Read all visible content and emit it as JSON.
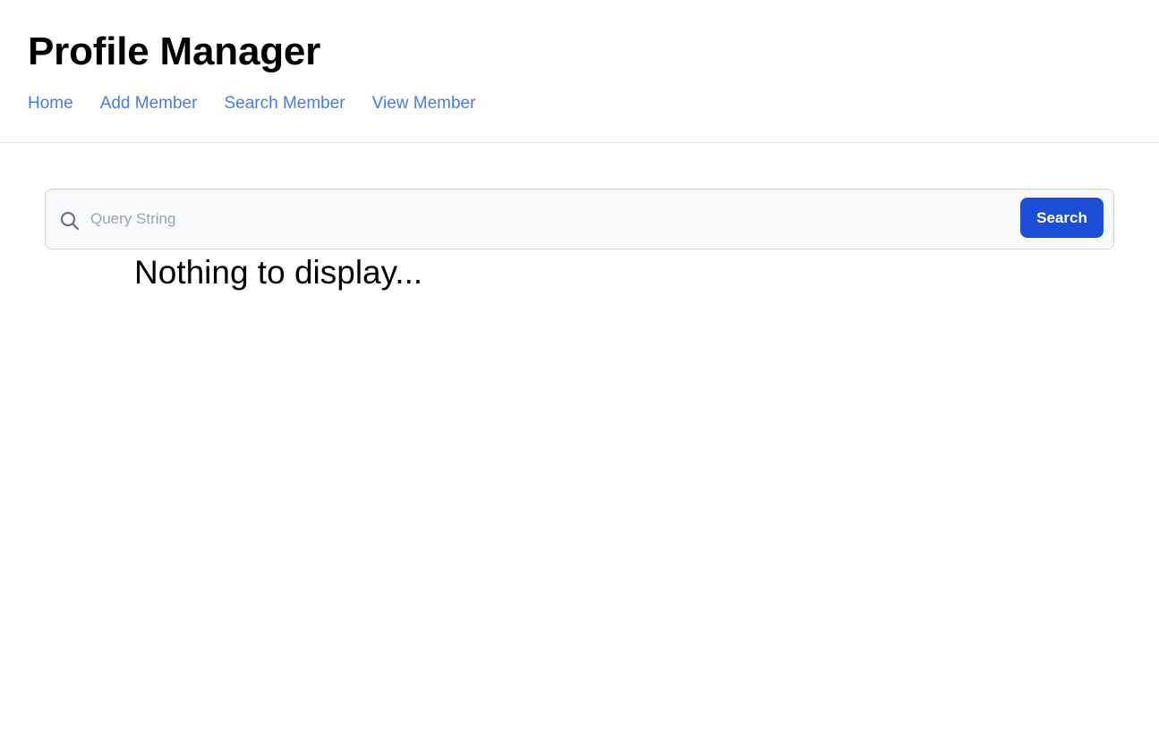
{
  "app": {
    "title": "Profile Manager"
  },
  "nav": {
    "items": [
      {
        "label": "Home"
      },
      {
        "label": "Add Member"
      },
      {
        "label": "Search Member"
      },
      {
        "label": "View Member"
      }
    ],
    "link_color": "#4a7ae8"
  },
  "search": {
    "placeholder": "Query String",
    "value": "",
    "icon": "search-icon",
    "button_label": "Search",
    "button_color": "#1d4ed8"
  },
  "results": {
    "empty_message": "Nothing to display..."
  }
}
